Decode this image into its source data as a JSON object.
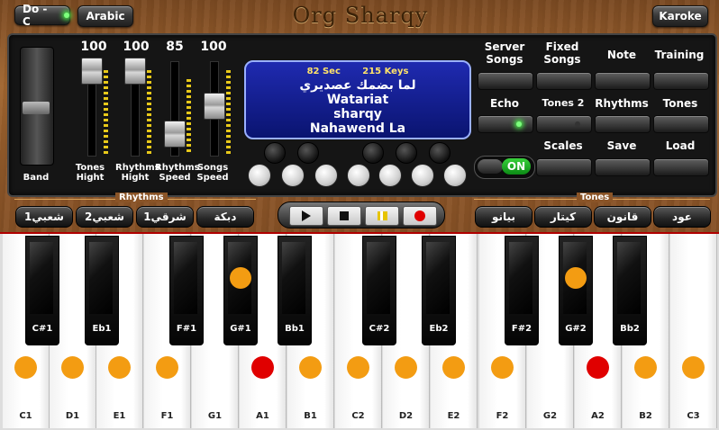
{
  "header": {
    "title": "Org Sharqy",
    "doc_label": "Do - C",
    "language_label": "Arabic",
    "karoke_label": "Karoke"
  },
  "mixer": {
    "band_label": "Band",
    "faders": [
      {
        "label": "Tones\nHight",
        "value": "100"
      },
      {
        "label": "Rhythms\nHight",
        "value": "100"
      },
      {
        "label": "Rhythms\nSpeed",
        "value": "85"
      },
      {
        "label": "Songs\nSpeed",
        "value": "100"
      }
    ]
  },
  "display": {
    "time": "82 Sec",
    "keys": "215 Keys",
    "line1": "لما بضمك عصديري",
    "line2": "Watariat",
    "line3": "sharqy",
    "line4": "Nahawend  La"
  },
  "controls": {
    "server_songs": "Server\nSongs",
    "fixed_songs": "Fixed\nSongs",
    "note": "Note",
    "training": "Training",
    "echo": "Echo",
    "tones2": "Tones 2",
    "rhythms": "Rhythms",
    "tones": "Tones",
    "scales": "Scales",
    "save": "Save",
    "load": "Load",
    "switch_label": "ON"
  },
  "rhythms_section": {
    "label": "Rhythms",
    "items": [
      "شعبي1",
      "شعبي2",
      "شرقي1",
      "دبكة"
    ]
  },
  "tones_section": {
    "label": "Tones",
    "items": [
      "بيانو",
      "كيتار",
      "قانون",
      "عود"
    ]
  },
  "keyboard": {
    "white_keys": [
      "C1",
      "D1",
      "E1",
      "F1",
      "G1",
      "A1",
      "B1",
      "C2",
      "D2",
      "E2",
      "F2",
      "G2",
      "A2",
      "B2",
      "C3"
    ],
    "black_keys": [
      "C#1",
      "Eb1",
      "F#1",
      "G#1",
      "Bb1",
      "C#2",
      "Eb2",
      "F#2",
      "G#2",
      "Bb2"
    ],
    "highlighted_red": [
      "A1",
      "A2"
    ],
    "highlighted_black": [
      "G#1",
      "G#2"
    ]
  },
  "colors": {
    "dot_orange": "#f39c12",
    "dot_red": "#e00000",
    "screen_blue": "#1f2ab0",
    "led_green": "#4cff4c"
  }
}
